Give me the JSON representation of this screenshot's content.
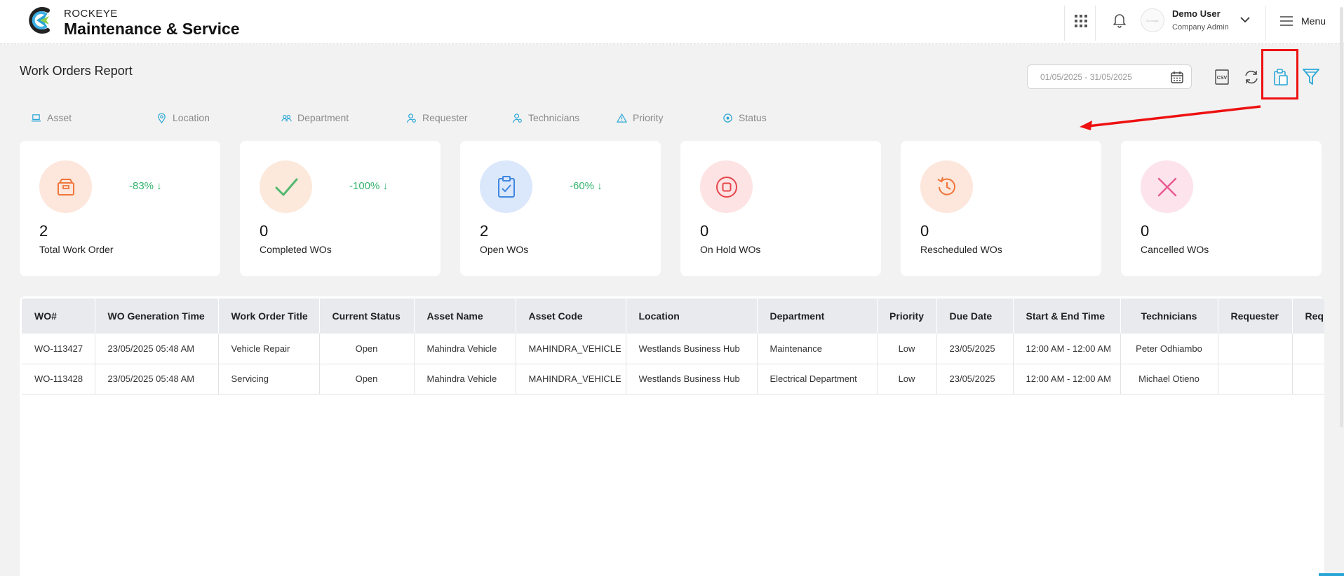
{
  "header": {
    "brand_small": "ROCKEYE",
    "brand_big": "Maintenance & Service",
    "user": {
      "avatar_text": "No Image",
      "name": "Demo User",
      "role": "Company Admin"
    },
    "menu_label": "Menu"
  },
  "page": {
    "title": "Work Orders Report",
    "date_range": "01/05/2025 - 31/05/2025"
  },
  "filters": [
    {
      "label": "Asset",
      "icon": "laptop-icon"
    },
    {
      "label": "Location",
      "icon": "map-pin-icon"
    },
    {
      "label": "Department",
      "icon": "users-icon"
    },
    {
      "label": "Requester",
      "icon": "user-icon"
    },
    {
      "label": "Technicians",
      "icon": "user-icon"
    },
    {
      "label": "Priority",
      "icon": "warning-icon"
    },
    {
      "label": "Status",
      "icon": "target-icon"
    }
  ],
  "cards": [
    {
      "value": "2",
      "label": "Total Work Order",
      "change": "-83% ↓",
      "icon": "box-icon",
      "bg": "#fde6db",
      "color": "#f0763a"
    },
    {
      "value": "0",
      "label": "Completed WOs",
      "change": "-100% ↓",
      "icon": "check-icon",
      "bg": "#fce9dc",
      "color": "#52b86f"
    },
    {
      "value": "2",
      "label": "Open WOs",
      "change": "-60% ↓",
      "icon": "clipboard-check-icon",
      "bg": "#dbe7fb",
      "color": "#3f87e0"
    },
    {
      "value": "0",
      "label": "On Hold WOs",
      "change": "",
      "icon": "stop-icon",
      "bg": "#fde3e3",
      "color": "#e6454a"
    },
    {
      "value": "0",
      "label": "Rescheduled WOs",
      "change": "",
      "icon": "history-icon",
      "bg": "#fde6db",
      "color": "#f0763a"
    },
    {
      "value": "0",
      "label": "Cancelled WOs",
      "change": "",
      "icon": "x-icon",
      "bg": "#fce3ec",
      "color": "#e85a90"
    }
  ],
  "table": {
    "columns": [
      "WO#",
      "WO Generation Time",
      "Work Order Title",
      "Current Status",
      "Asset Name",
      "Asset Code",
      "Location",
      "Department",
      "Priority",
      "Due Date",
      "Start & End Time",
      "Technicians",
      "Requester",
      "Req"
    ],
    "rows": [
      [
        "WO-113427",
        "23/05/2025 05:48 AM",
        "Vehicle Repair",
        "Open",
        "Mahindra Vehicle",
        "MAHINDRA_VEHICLE",
        "Westlands Business Hub",
        "Maintenance",
        "Low",
        "23/05/2025",
        "12:00 AM - 12:00 AM",
        "Peter Odhiambo",
        "",
        ""
      ],
      [
        "WO-113428",
        "23/05/2025 05:48 AM",
        "Servicing",
        "Open",
        "Mahindra Vehicle",
        "MAHINDRA_VEHICLE",
        "Westlands Business Hub",
        "Electrical Department",
        "Low",
        "23/05/2025",
        "12:00 AM - 12:00 AM",
        "Michael Otieno",
        "",
        ""
      ]
    ]
  },
  "colors": {
    "accent": "#2aa6d6",
    "highlight": "#ee1111",
    "positive": "#35b36e"
  }
}
